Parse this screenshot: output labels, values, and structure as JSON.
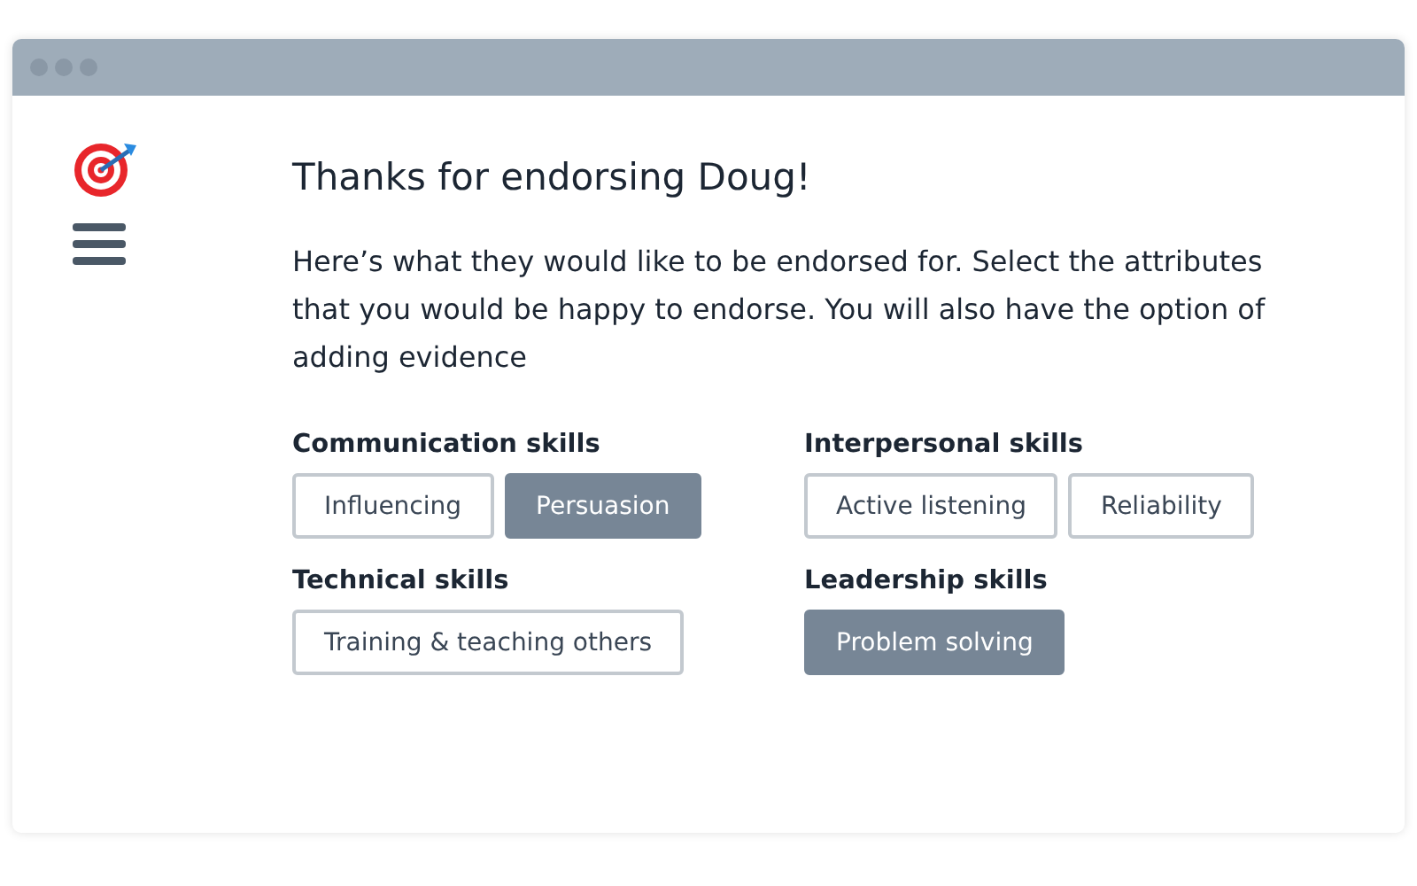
{
  "heading": "Thanks for endorsing Doug!",
  "intro": "Here’s what they would like to be endorsed for. Select the attributes that you would be happy to endorse. You will also have the option of adding evidence",
  "groups": [
    {
      "title": "Communication skills",
      "skills": [
        {
          "label": "Influencing",
          "selected": false
        },
        {
          "label": "Persuasion",
          "selected": true
        }
      ]
    },
    {
      "title": "Interpersonal skills",
      "skills": [
        {
          "label": "Active listening",
          "selected": false
        },
        {
          "label": "Reliability",
          "selected": false
        }
      ]
    },
    {
      "title": "Technical skills",
      "skills": [
        {
          "label": "Training & teaching others",
          "selected": false
        }
      ]
    },
    {
      "title": "Leadership skills",
      "skills": [
        {
          "label": "Problem solving",
          "selected": true
        }
      ]
    }
  ]
}
